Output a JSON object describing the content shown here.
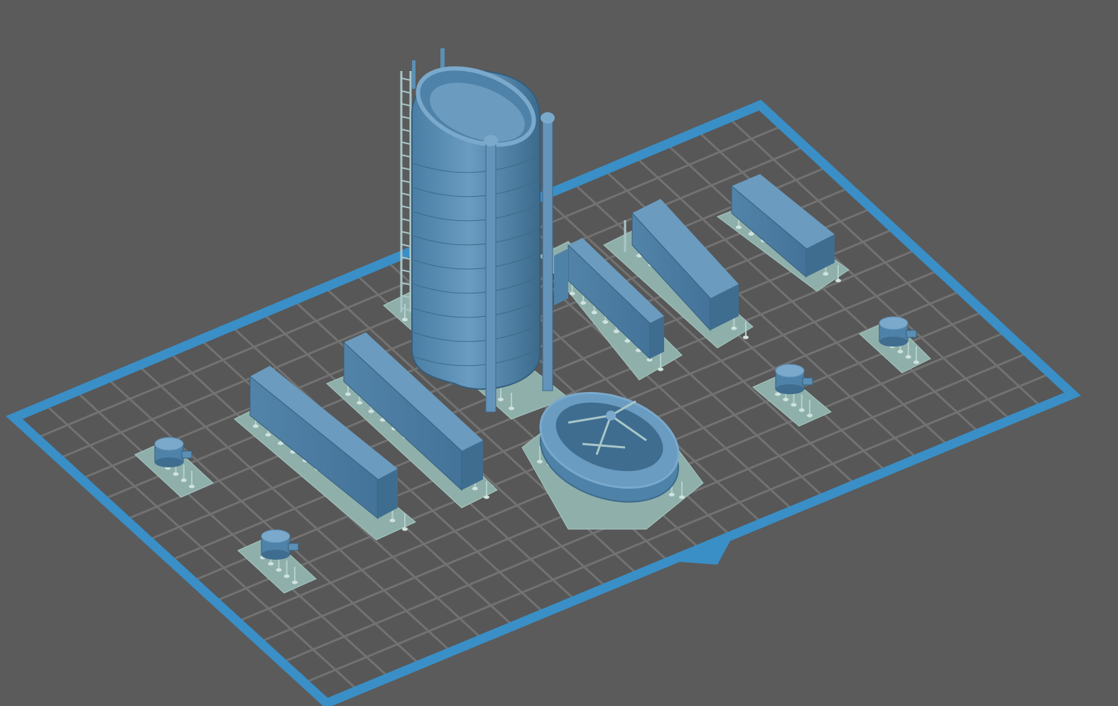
{
  "viewport": {
    "background": "#5b5b5b",
    "plate_border_color": "#3a8fc7",
    "grid_line_color": "#6e6e6e",
    "model_color": "#5b8fb4",
    "model_dark_color": "#3f6d90",
    "model_light_color": "#7aa9cc",
    "support_color": "#9fc0bb",
    "support_pad_color": "#8fb0aa"
  },
  "scene": {
    "objects": [
      {
        "name": "tall-tank",
        "kind": "tank"
      },
      {
        "name": "oval-ring",
        "kind": "ring"
      },
      {
        "name": "wall-panel-a",
        "kind": "wall"
      },
      {
        "name": "wall-panel-b",
        "kind": "wall"
      },
      {
        "name": "wall-panel-c",
        "kind": "wall"
      },
      {
        "name": "wall-panel-d",
        "kind": "wall"
      },
      {
        "name": "wall-panel-e",
        "kind": "wall"
      },
      {
        "name": "small-tank-1",
        "kind": "small-tank"
      },
      {
        "name": "small-tank-2",
        "kind": "small-tank"
      },
      {
        "name": "small-tank-3",
        "kind": "small-tank"
      },
      {
        "name": "small-tank-4",
        "kind": "small-tank"
      }
    ]
  }
}
